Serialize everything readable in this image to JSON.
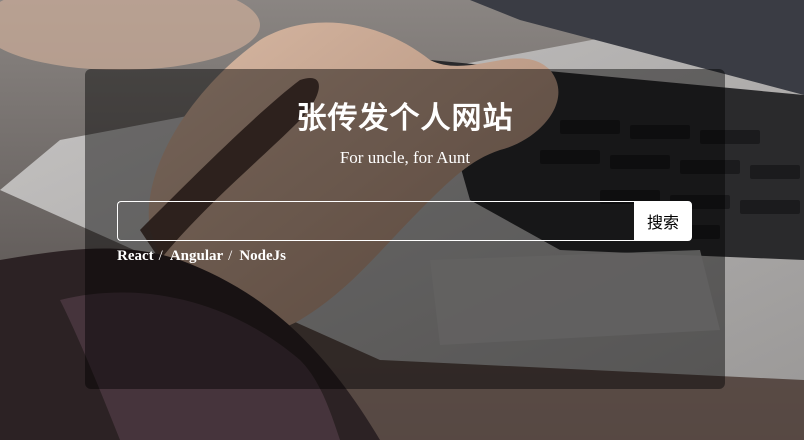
{
  "site": {
    "title": "张传发个人网站",
    "subtitle": "For uncle, for Aunt"
  },
  "search": {
    "value": "",
    "placeholder": "",
    "button_label": "搜索"
  },
  "tags": [
    {
      "label": "React",
      "separator": "/"
    },
    {
      "label": "Angular",
      "separator": "/"
    },
    {
      "label": "NodeJs",
      "separator": ""
    }
  ]
}
